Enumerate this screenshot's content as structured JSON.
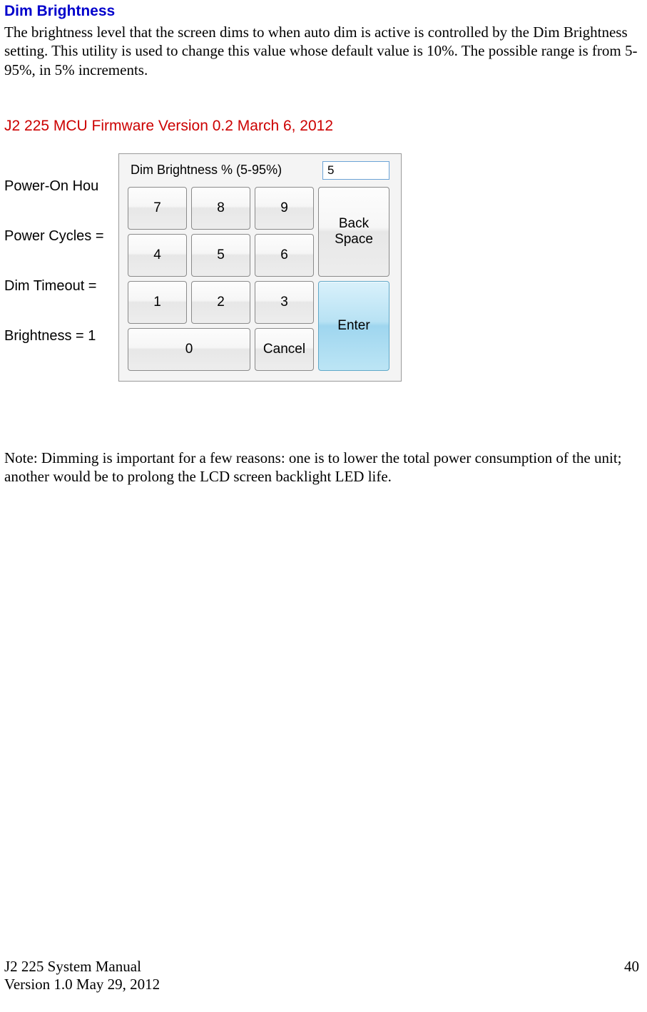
{
  "heading": "Dim Brightness",
  "paragraph1": "The brightness level that the screen dims to when auto dim is active is controlled by the Dim Brightness setting. This utility is used to change this value whose default value is 10%. The possible range is from 5-95%, in 5% increments.",
  "firmware": "J2 225 MCU Firmware Version 0.2 March 6, 2012",
  "bg_labels": {
    "l1": "Power-On Hou",
    "l2": "Power Cycles =",
    "l3": "Dim Timeout =",
    "l4": "Brightness = 1"
  },
  "keypad": {
    "label": "Dim Brightness % (5-95%)",
    "value": "5",
    "keys": {
      "k7": "7",
      "k8": "8",
      "k9": "9",
      "k4": "4",
      "k5": "5",
      "k6": "6",
      "k1": "1",
      "k2": "2",
      "k3": "3",
      "k0": "0",
      "backspace": "Back\nSpace",
      "cancel": "Cancel",
      "enter": "Enter"
    }
  },
  "note": "Note: Dimming is important for a few reasons: one is to lower the total power consumption of the unit; another would be to prolong the LCD screen backlight LED life.",
  "footer": {
    "manual": "J2 225 System Manual",
    "version": "Version 1.0 May 29, 2012",
    "page": "40"
  }
}
